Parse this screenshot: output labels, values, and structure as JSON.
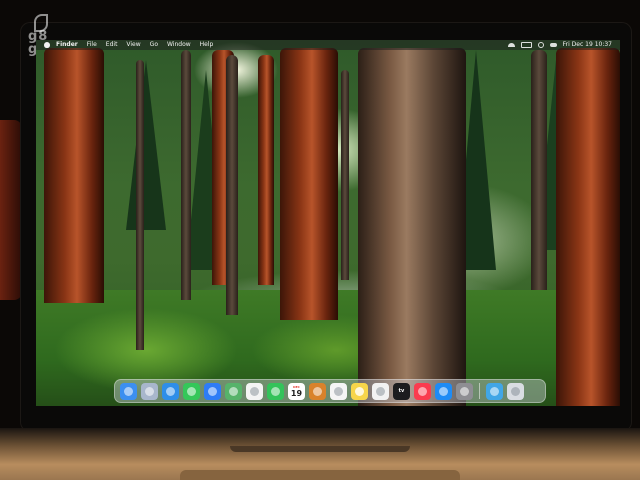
{
  "menubar": {
    "app_name": "Finder",
    "items": [
      "File",
      "Edit",
      "View",
      "Go",
      "Window",
      "Help"
    ],
    "clock": "Fri Dec 19  10:37"
  },
  "dock": {
    "apps": [
      {
        "name": "Finder",
        "icon": "finder-icon",
        "color": "#3c8ff0"
      },
      {
        "name": "Launchpad",
        "icon": "launchpad-icon",
        "color": "#a8b6cc"
      },
      {
        "name": "Safari",
        "icon": "safari-icon",
        "color": "#2f8ee8"
      },
      {
        "name": "Messages",
        "icon": "messages-icon",
        "color": "#34c759"
      },
      {
        "name": "Mail",
        "icon": "mail-icon",
        "color": "#2e7cf6"
      },
      {
        "name": "Maps",
        "icon": "maps-icon",
        "color": "#56b36a"
      },
      {
        "name": "Photos",
        "icon": "photos-icon",
        "color": "#f4f4f4"
      },
      {
        "name": "FaceTime",
        "icon": "facetime-icon",
        "color": "#33c35a"
      },
      {
        "name": "Calendar",
        "icon": "calendar-icon",
        "color": "#ffffff",
        "month": "DEC",
        "day": "19"
      },
      {
        "name": "Contacts",
        "icon": "contacts-icon",
        "color": "#d9822b"
      },
      {
        "name": "Reminders",
        "icon": "reminders-icon",
        "color": "#f5f5f5"
      },
      {
        "name": "Notes",
        "icon": "notes-icon",
        "color": "#f7d54a"
      },
      {
        "name": "Freeform",
        "icon": "freeform-icon",
        "color": "#f2f2f2"
      },
      {
        "name": "TV",
        "icon": "tv-icon",
        "color": "#1c1c1e",
        "label": "tv"
      },
      {
        "name": "Music",
        "icon": "music-icon",
        "color": "#fa3b4f"
      },
      {
        "name": "App Store",
        "icon": "app-store-icon",
        "color": "#1e8bf5"
      },
      {
        "name": "System Settings",
        "icon": "settings-icon",
        "color": "#8e8e93"
      },
      {
        "name": "Downloads",
        "icon": "downloads-folder-icon",
        "color": "#41a6e6"
      },
      {
        "name": "Trash",
        "icon": "trash-icon",
        "color": "#d9dde2"
      }
    ]
  }
}
